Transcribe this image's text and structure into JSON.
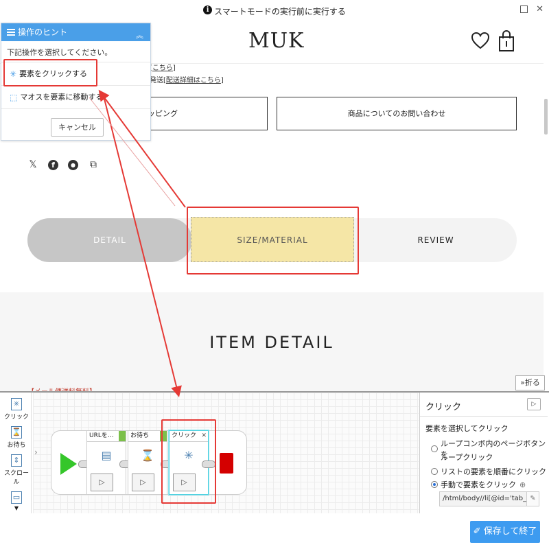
{
  "banner": {
    "text": "スマートモードの実行前に実行する",
    "info_icon": "info-icon"
  },
  "site": {
    "logo": "MUK",
    "shipping_text_1": "こちら",
    "shipping_text_2a": "発送",
    "shipping_text_2b": "配送詳細はこちら",
    "btn_shopping": "ッピング",
    "btn_inquiry": "商品についてのお問い合わせ",
    "social": [
      "x-icon",
      "facebook-icon",
      "line-icon",
      "copy-link-icon"
    ],
    "tabs": {
      "detail": "DETAIL",
      "size": "SIZE/MATERIAL",
      "review": "REVIEW"
    },
    "section_title": "ITEM DETAIL",
    "note": "【メール便送料無料】"
  },
  "hint": {
    "title": "操作のヒント",
    "subtitle": "下記操作を選択してください。",
    "option_click": "要素をクリックする",
    "option_hover": "マオスを要素に移動する",
    "cancel": "キャンセル"
  },
  "designer": {
    "fold": "折る",
    "tools": [
      {
        "label": "クリック",
        "icon": "click-icon"
      },
      {
        "label": "お待ち",
        "icon": "hourglass-icon"
      },
      {
        "label": "スクロール",
        "icon": "scroll-icon"
      }
    ],
    "blocks": [
      {
        "title": "URLを…",
        "icon": "url-icon"
      },
      {
        "title": "お待ち",
        "icon": "hourglass-icon"
      },
      {
        "title": "クリック",
        "icon": "click-icon"
      }
    ]
  },
  "props": {
    "title": "クリック",
    "subtitle": "要素を選択してクリック",
    "opt1_line1": "ループコンボ内のページボタンを",
    "opt1_line2": "ループクリック",
    "opt2": "リストの要素を順番にクリック",
    "opt3": "手動で要素をクリック",
    "xpath": "/html/body//li[@id='tab_b"
  },
  "footer": {
    "save": "保存して終了"
  },
  "colors": {
    "accent": "#3d9bf0",
    "annotation": "#e53935",
    "start": "#35c62a",
    "stop": "#d40000",
    "tab_highlight": "#f5e6a6"
  }
}
